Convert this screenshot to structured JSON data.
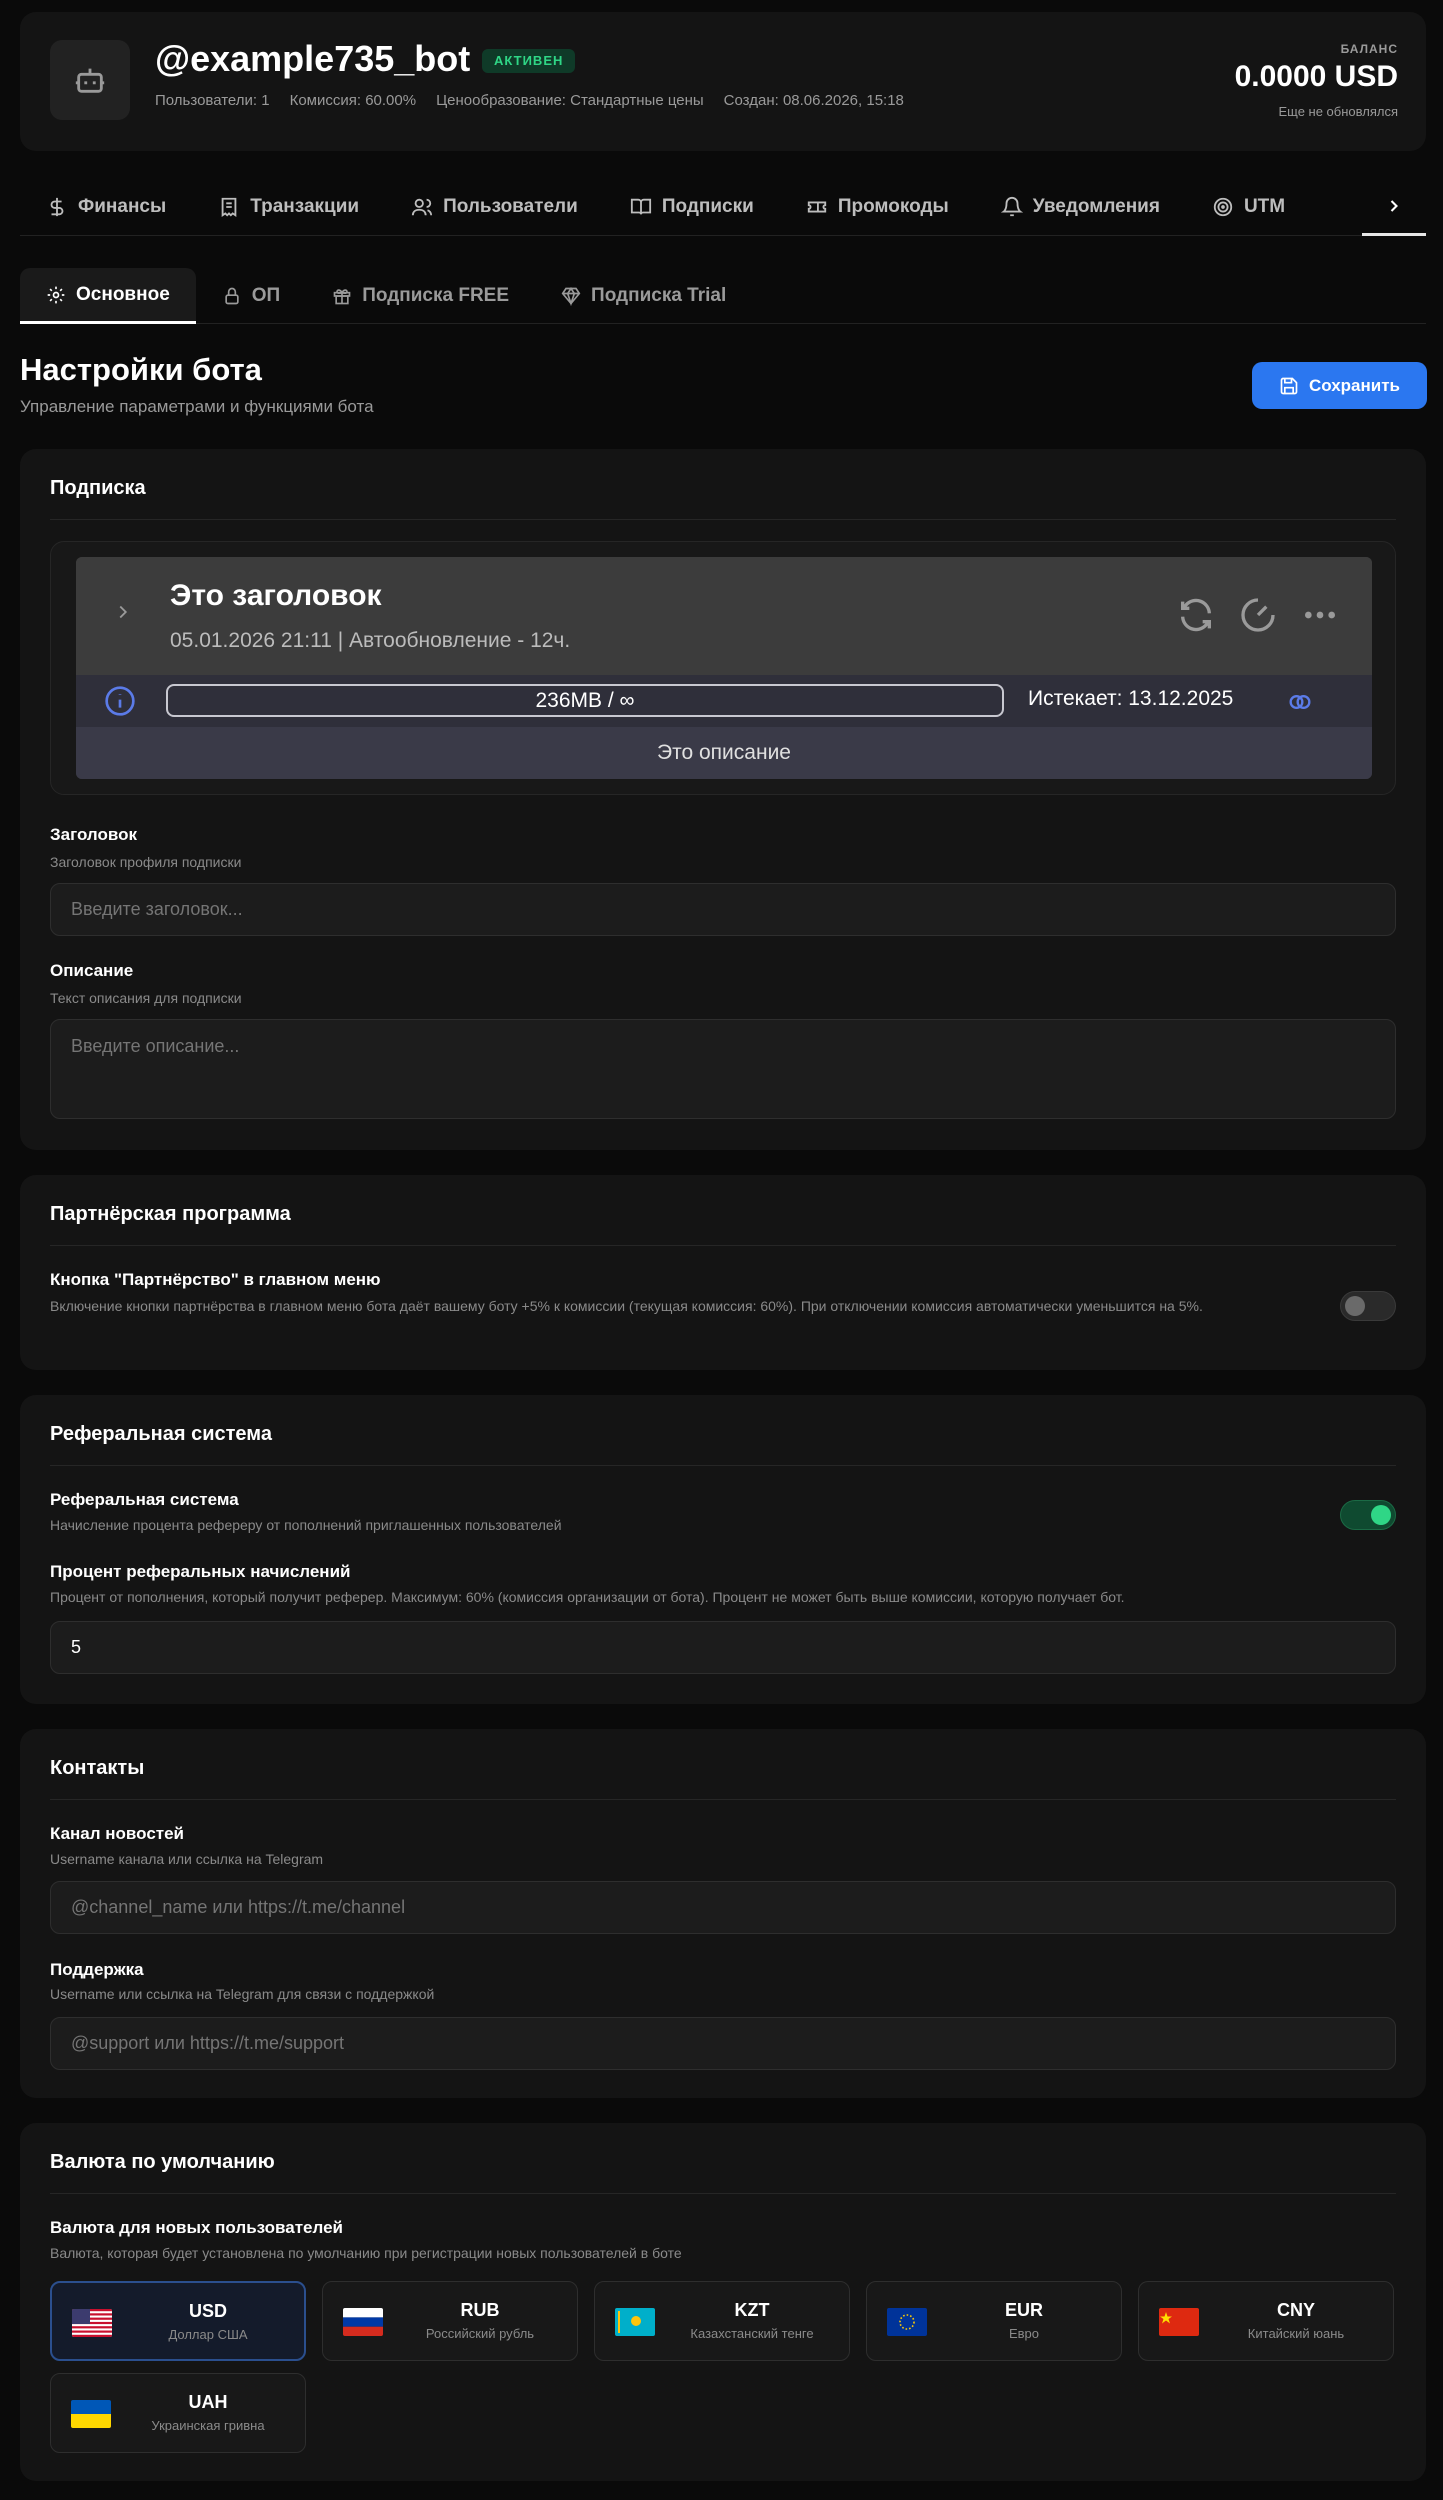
{
  "header": {
    "bot_name": "@example735_bot",
    "status": "АКТИВЕН",
    "meta": [
      "Пользователи: 1",
      "Комиссия: 60.00%",
      "Ценообразование: Стандартные цены",
      "Создан: 08.06.2026, 15:18"
    ],
    "balance_label": "БАЛАНС",
    "balance_value": "0.0000 USD",
    "balance_note": "Еще не обновлялся"
  },
  "nav": [
    {
      "label": "Финансы",
      "icon": "dollar-icon"
    },
    {
      "label": "Транзакции",
      "icon": "receipt-icon"
    },
    {
      "label": "Пользователи",
      "icon": "users-icon"
    },
    {
      "label": "Подписки",
      "icon": "book-icon"
    },
    {
      "label": "Промокоды",
      "icon": "ticket-icon"
    },
    {
      "label": "Уведомления",
      "icon": "bell-icon"
    },
    {
      "label": "UTM",
      "icon": "target-icon"
    }
  ],
  "sub_tabs": [
    {
      "label": "Основное",
      "icon": "gear-icon"
    },
    {
      "label": "ОП",
      "icon": "lock-icon"
    },
    {
      "label": "Подписка FREE",
      "icon": "gift-icon"
    },
    {
      "label": "Подписка Trial",
      "icon": "diamond-icon"
    }
  ],
  "page": {
    "title": "Настройки бота",
    "subtitle": "Управление параметрами и функциями бота",
    "save_label": "Сохранить"
  },
  "subscription": {
    "title": "Подписка",
    "preview": {
      "title": "Это заголовок",
      "date": "05.01.2026 21:11 | Автообновление - 12ч.",
      "traffic": "236MB / ∞",
      "expires": "Истекает: 13.12.2025",
      "description": "Это описание"
    },
    "header_label": "Заголовок",
    "header_hint": "Заголовок профиля подписки",
    "header_placeholder": "Введите заголовок...",
    "desc_label": "Описание",
    "desc_hint": "Текст описания для подписки",
    "desc_placeholder": "Введите описание..."
  },
  "partner": {
    "title": "Партнёрская программа",
    "label": "Кнопка \"Партнёрство\" в главном меню",
    "hint": "Включение кнопки партнёрства в главном меню бота даёт вашему боту +5% к комиссии (текущая комиссия: 60%). При отключении комиссия автоматически уменьшится на 5%.",
    "enabled": false
  },
  "referral": {
    "title": "Реферальная система",
    "label": "Реферальная система",
    "hint": "Начисление процента рефереру от пополнений приглашенных пользователей",
    "enabled": true,
    "percent_label": "Процент реферальных начислений",
    "percent_hint": "Процент от пополнения, который получит реферер. Максимум: 60% (комиссия организации от бота). Процент не может быть выше комиссии, которую получает бот.",
    "percent_value": "5"
  },
  "contacts": {
    "title": "Контакты",
    "channel_label": "Канал новостей",
    "channel_hint": "Username канала или ссылка на Telegram",
    "channel_placeholder": "@channel_name или https://t.me/channel",
    "support_label": "Поддержка",
    "support_hint": "Username или ссылка на Telegram для связи с поддержкой",
    "support_placeholder": "@support или https://t.me/support"
  },
  "currency": {
    "title": "Валюта по умолчанию",
    "label": "Валюта для новых пользователей",
    "hint": "Валюта, которая будет установлена по умолчанию при регистрации новых пользователей в боте",
    "selected": "USD",
    "options": [
      {
        "code": "USD",
        "name": "Доллар США",
        "flag": "us-flag-icon"
      },
      {
        "code": "RUB",
        "name": "Российский рубль",
        "flag": "ru-flag-icon"
      },
      {
        "code": "KZT",
        "name": "Казахстанский тенге",
        "flag": "kz-flag-icon"
      },
      {
        "code": "EUR",
        "name": "Евро",
        "flag": "eu-flag-icon"
      },
      {
        "code": "CNY",
        "name": "Китайский юань",
        "flag": "cn-flag-icon"
      },
      {
        "code": "UAH",
        "name": "Украинская гривна",
        "flag": "ua-flag-icon"
      }
    ]
  },
  "colors": {
    "accent": "#2b77f0",
    "success": "#2fd686",
    "background": "#0a0a0a",
    "card": "#141414"
  }
}
